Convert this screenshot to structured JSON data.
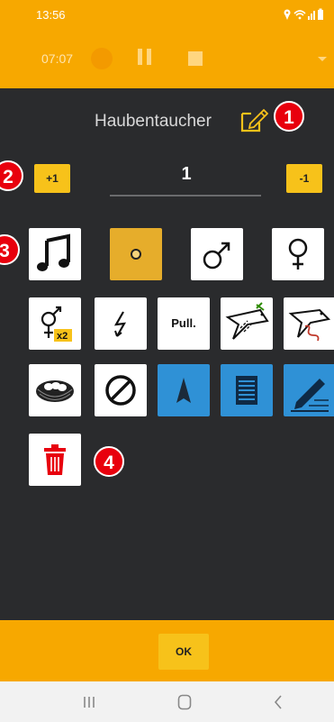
{
  "status_bar": {
    "time": "13:56",
    "icons": [
      "location-icon",
      "wifi-icon",
      "signal-icon",
      "battery-icon"
    ]
  },
  "toolbar": {
    "timer": "07:07",
    "icons": [
      "record-icon",
      "pause-icon",
      "stop-icon",
      "dropdown-arrow-icon"
    ]
  },
  "header": {
    "species": "Haubentaucher",
    "edit_icon": "edit-icon"
  },
  "counter": {
    "plus_label": "+1",
    "value": "1",
    "minus_label": "-1"
  },
  "markers": [
    "1",
    "2",
    "3",
    "4"
  ],
  "tiles": {
    "song": "music-note-icon",
    "plain": "circle-icon",
    "male": "male-symbol-icon",
    "female": "female-symbol-icon",
    "pair": {
      "icon": "pair-symbol-icon",
      "label": "x2"
    },
    "flash": "lightning-icon",
    "pull": "Pull.",
    "fly_dash": "flying-bird-dashed-icon",
    "fly_wave": "flying-bird-wavy-icon",
    "nest": "nest-icon",
    "none": "forbidden-icon",
    "direction": "direction-arrow-icon",
    "notes": "notes-icon",
    "write": "pen-icon",
    "delete": "trash-icon"
  },
  "footer": {
    "ok_label": "OK"
  },
  "nav": [
    "recent-apps-icon",
    "home-icon",
    "back-icon"
  ],
  "colors": {
    "accent": "#f7a800",
    "button": "#f7c21a",
    "selected_tile": "#e6ad2b",
    "blue_tile": "#2f91d6",
    "badge": "#e8000d",
    "background": "#2a2b2d"
  }
}
